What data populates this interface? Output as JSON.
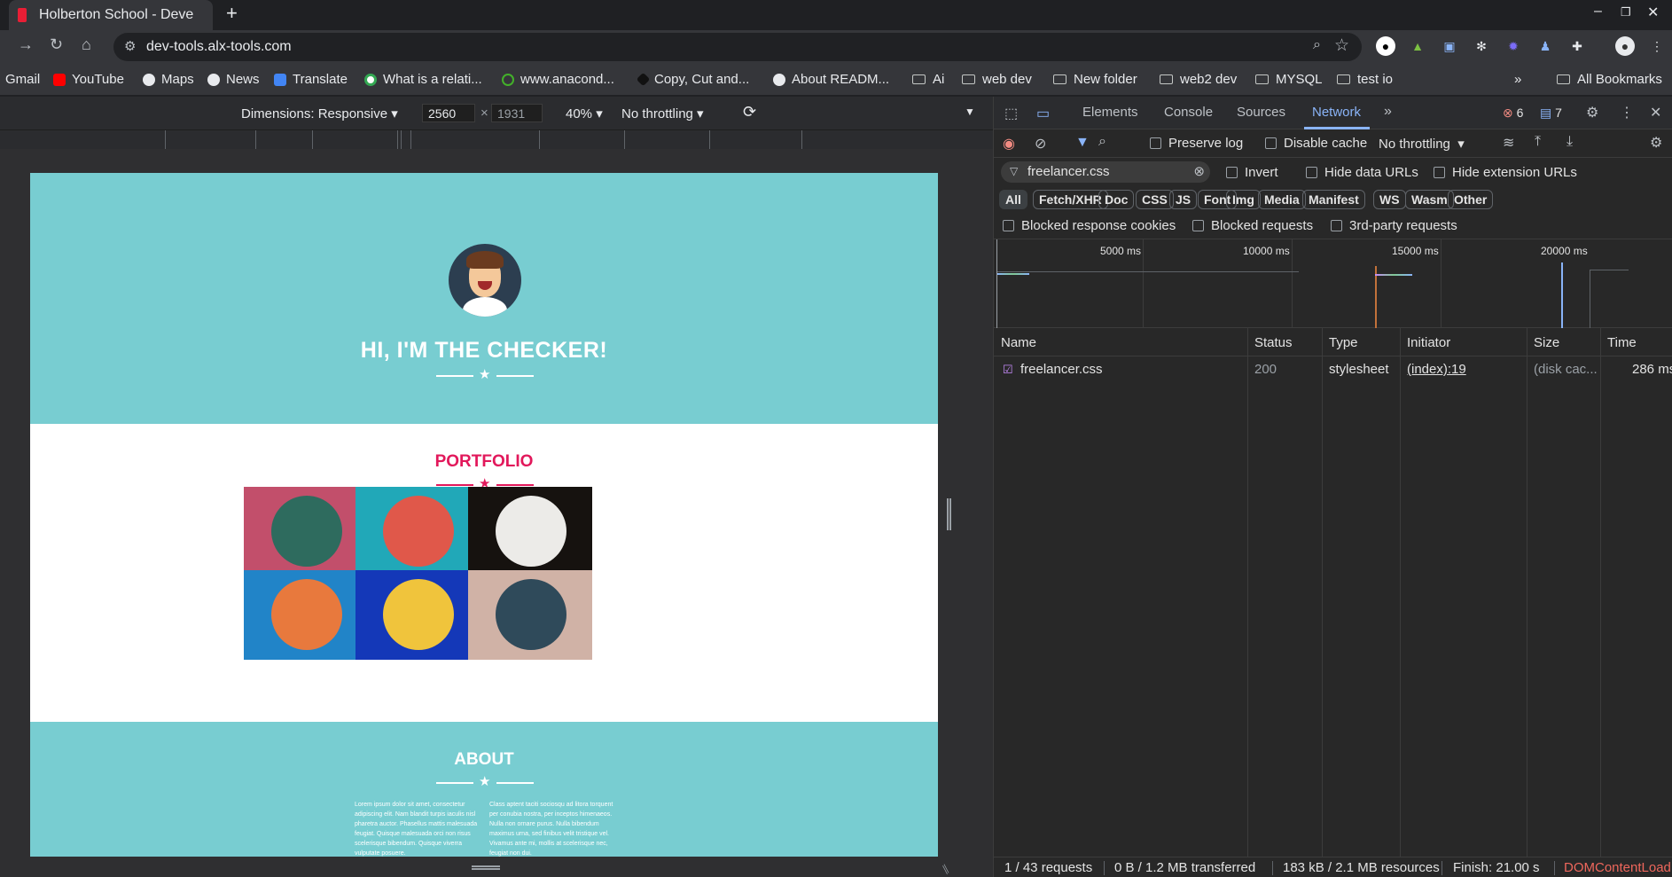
{
  "browser": {
    "tab_title": "Holberton School - Deve",
    "url": "dev-tools.alx-tools.com",
    "bookmarks": [
      "Gmail",
      "YouTube",
      "Maps",
      "News",
      "Translate",
      "What is a relati...",
      "www.anacond...",
      "Copy, Cut and...",
      "About READM...",
      "Ai",
      "web dev",
      "New folder",
      "web2 dev",
      "MYSQL",
      "test io"
    ],
    "all_bookmarks": "All Bookmarks"
  },
  "device_toolbar": {
    "dimensions_label": "Dimensions: Responsive",
    "width": "2560",
    "height": "1931",
    "times": "×",
    "zoom": "40%",
    "throttling": "No throttling"
  },
  "page": {
    "hero_title": "HI, I'M THE CHECKER!",
    "portfolio_title": "PORTFOLIO",
    "about_title": "ABOUT",
    "about_col1": "Lorem ipsum dolor sit amet, consectetur adipiscing elit. Nam blandit turpis iaculis nisl pharetra auctor. Phasellus mattis malesuada feugiat. Quisque malesuada orci non risus scelerisque bibendum. Quisque viverra vulputate posuere.",
    "about_col2": "Class aptent taciti sociosqu ad litora torquent per conubia nostra, per inceptos himenaeos. Nulla non ornare purus. Nulla bibendum maximus urna, sed finibus velit tristique vel. Vivamus ante mi, mollis at scelerisque nec, feugiat non dui.",
    "tiles": [
      {
        "bg": "#c24f6b",
        "circle": "#2e6b5e",
        "icon": "cabin-icon"
      },
      {
        "bg": "#21a8b8",
        "circle": "#e0584a",
        "icon": "cake-icon"
      },
      {
        "bg": "#16120f",
        "circle": "#ecebe8",
        "icon": "circus-tent-icon"
      },
      {
        "bg": "#2184c8",
        "circle": "#e8793d",
        "icon": "game-controller-icon"
      },
      {
        "bg": "#1438b8",
        "circle": "#f0c43c",
        "icon": "safe-icon"
      },
      {
        "bg": "#d0b2a6",
        "circle": "#2f4a5a",
        "icon": "submarine-icon"
      }
    ]
  },
  "devtools": {
    "tabs": [
      "Elements",
      "Console",
      "Sources",
      "Network"
    ],
    "active_tab": "Network",
    "error_count": "6",
    "message_count": "7",
    "preserve_log": "Preserve log",
    "disable_cache": "Disable cache",
    "throttling": "No throttling",
    "filter_value": "freelancer.css",
    "invert": "Invert",
    "hide_data_urls": "Hide data URLs",
    "hide_extension_urls": "Hide extension URLs",
    "type_filters": [
      "All",
      "Fetch/XHR",
      "Doc",
      "CSS",
      "JS",
      "Font",
      "Img",
      "Media",
      "Manifest",
      "WS",
      "Wasm",
      "Other"
    ],
    "blocked_response_cookies": "Blocked response cookies",
    "blocked_requests": "Blocked requests",
    "third_party": "3rd-party requests",
    "overview_ticks": [
      "5000 ms",
      "10000 ms",
      "15000 ms",
      "20000 ms"
    ],
    "columns": [
      "Name",
      "Status",
      "Type",
      "Initiator",
      "Size",
      "Time"
    ],
    "rows": [
      {
        "name": "freelancer.css",
        "status": "200",
        "type": "stylesheet",
        "initiator": "(index):19",
        "size": "(disk cac...",
        "time": "286 ms"
      }
    ],
    "status": {
      "requests": "1 / 43 requests",
      "transferred": "0 B / 1.2 MB transferred",
      "resources": "183 kB / 2.1 MB resources",
      "finish": "Finish: 21.00 s",
      "dcl": "DOMContentLoad"
    }
  }
}
